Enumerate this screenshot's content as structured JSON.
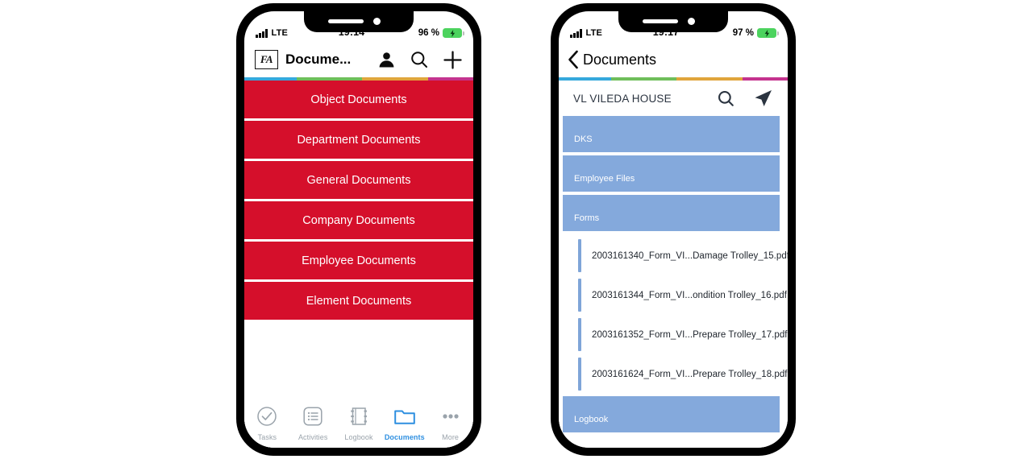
{
  "colors": {
    "red": "#D50F2B",
    "blue_row": "#84A9DC",
    "accent_blue": "#2E8FE0",
    "file_bar": "#7FA5D8",
    "rainbow": [
      "#35A8DC",
      "#6FBE5A",
      "#E0A53C",
      "#C4338E"
    ]
  },
  "phone_left": {
    "status_bar": {
      "carrier": "LTE",
      "time": "19:14",
      "battery_percent": "96 %",
      "signal_icon": "signal-bars-icon",
      "battery_icon": "battery-charging-icon"
    },
    "nav_bar": {
      "logo": "FA",
      "logo_icon": "fa-logo-icon",
      "title": "Docume...",
      "actions": [
        {
          "name": "person-icon",
          "label": "Account"
        },
        {
          "name": "search-icon",
          "label": "Search"
        },
        {
          "name": "plus-icon",
          "label": "Add"
        }
      ]
    },
    "documents_list": [
      {
        "label": "Object Documents"
      },
      {
        "label": "Department Documents"
      },
      {
        "label": "General Documents"
      },
      {
        "label": "Company Documents"
      },
      {
        "label": "Employee Documents"
      },
      {
        "label": "Element Documents"
      }
    ],
    "tab_bar": [
      {
        "label": "Tasks",
        "icon": "check-circle-icon",
        "active": false
      },
      {
        "label": "Activities",
        "icon": "list-icon",
        "active": false
      },
      {
        "label": "Logbook",
        "icon": "book-icon",
        "active": false
      },
      {
        "label": "Documents",
        "icon": "folder-icon",
        "active": true
      },
      {
        "label": "More",
        "icon": "ellipsis-icon",
        "active": false
      }
    ]
  },
  "phone_right": {
    "status_bar": {
      "carrier": "LTE",
      "time": "19:17",
      "battery_percent": "97 %",
      "signal_icon": "signal-bars-icon",
      "battery_icon": "battery-charging-icon"
    },
    "nav_bar": {
      "back_icon": "chevron-left-icon",
      "title": "Documents"
    },
    "search_row": {
      "value": "VL VILEDA HOUSE",
      "search_icon": "search-icon",
      "navigate_icon": "send-arrow-icon"
    },
    "folders": [
      {
        "label": "DKS"
      },
      {
        "label": "Employee Files"
      },
      {
        "label": "Forms"
      }
    ],
    "files": [
      {
        "name": "2003161340_Form_VI...Damage Trolley_15.pdf"
      },
      {
        "name": "2003161344_Form_VI...ondition Trolley_16.pdf"
      },
      {
        "name": "2003161352_Form_VI...Prepare Trolley_17.pdf"
      },
      {
        "name": "2003161624_Form_VI...Prepare Trolley_18.pdf"
      }
    ],
    "folders_bottom": [
      {
        "label": "Logbook"
      }
    ]
  }
}
